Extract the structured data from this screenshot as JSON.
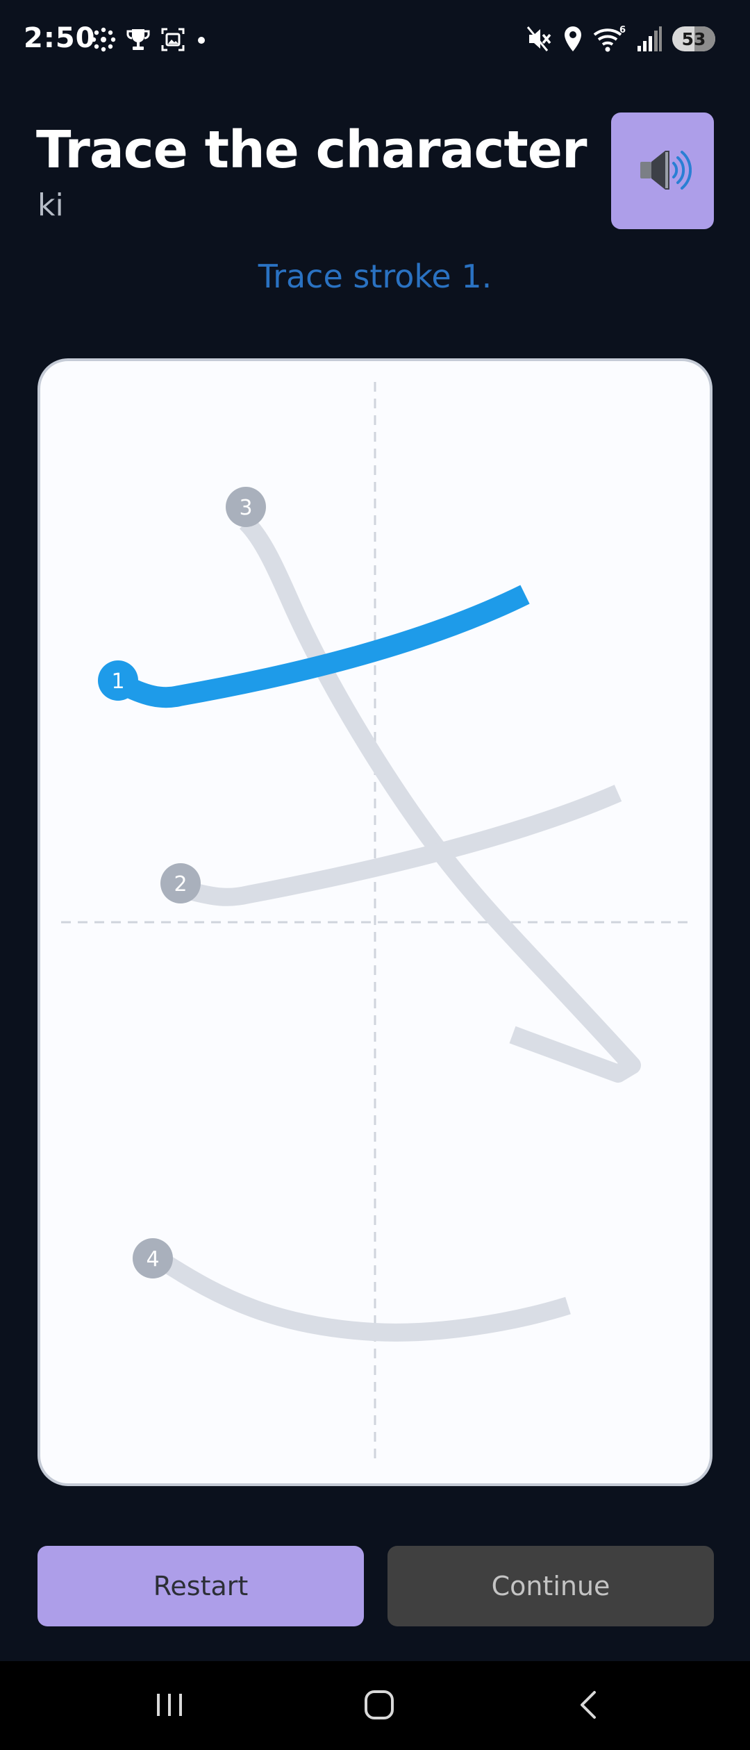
{
  "status_bar": {
    "time": "2:50",
    "battery_level": "53",
    "left_icons": [
      "settings-dots-icon",
      "trophy-icon",
      "screenshot-icon",
      "dot-icon"
    ],
    "right_icons": [
      "mute-icon",
      "location-icon",
      "wifi-icon",
      "signal-icon",
      "battery-icon"
    ],
    "wifi_badge": "6"
  },
  "header": {
    "title": "Trace the character",
    "romaji": "ki",
    "audio_icon": "speaker-icon",
    "audio_button_color": "#ad9ee9"
  },
  "instruction": "Trace stroke 1.",
  "canvas": {
    "current_stroke": 1,
    "active_color": "#1e9be9",
    "pending_color": "#d9dde5",
    "marker_pending_color": "#a9b0bc",
    "strokes": [
      {
        "number": "1",
        "state": "active"
      },
      {
        "number": "2",
        "state": "pending"
      },
      {
        "number": "3",
        "state": "pending"
      },
      {
        "number": "4",
        "state": "pending"
      }
    ]
  },
  "buttons": {
    "restart_label": "Restart",
    "continue_label": "Continue"
  },
  "nav_bar": {
    "icons": [
      "recents-icon",
      "home-icon",
      "back-icon"
    ]
  }
}
